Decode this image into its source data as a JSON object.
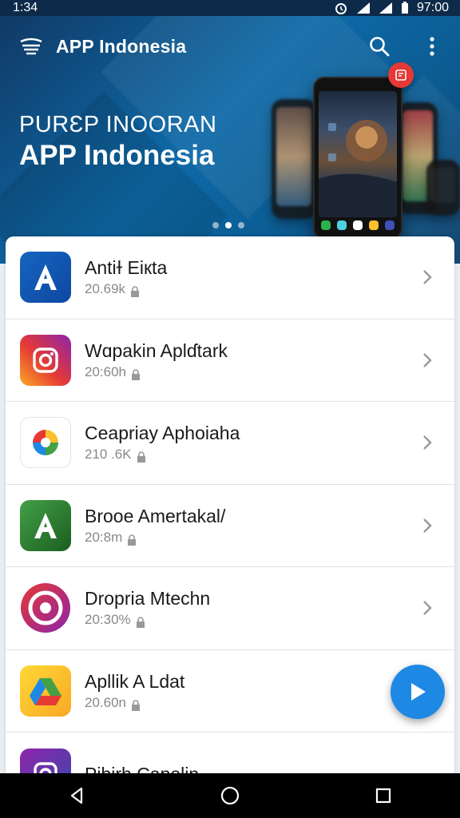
{
  "status_bar": {
    "time_left": "1:34",
    "time_right": "97:00"
  },
  "header": {
    "title": "APP Indonesia",
    "search_icon": "search-icon",
    "more_icon": "more-vert-icon"
  },
  "hero": {
    "subtitle": "PURƐP INOORAN",
    "title": "APP Indonesia",
    "badge_icon": "notification-badge-icon",
    "carousel_count": 3,
    "carousel_active": 1
  },
  "apps": [
    {
      "name": "Antiɫ Eiкta",
      "meta": "20.69k",
      "icon": "blue-a-app-icon"
    },
    {
      "name": "Wɑpakin Aplɗtark",
      "meta": "20:60h",
      "icon": "instagram-icon"
    },
    {
      "name": "Ceapriay Aphoiaha",
      "meta": "210 .6K",
      "icon": "google-photos-icon"
    },
    {
      "name": "Brooe Amertakal/",
      "meta": "20:8m",
      "icon": "green-a-app-icon"
    },
    {
      "name": "Dropria Mtechn",
      "meta": "20:30%",
      "icon": "target-app-icon"
    },
    {
      "name": "Apllik A Ldat",
      "meta": "20.60n",
      "icon": "drive-icon"
    },
    {
      "name": "Pibirh Capolin",
      "meta": "",
      "icon": "purple-app-icon"
    }
  ],
  "fab_icon": "play-icon",
  "colors": {
    "accent": "#1e88e5",
    "header_dark": "#103a66",
    "header_light": "#0e6aa8"
  }
}
